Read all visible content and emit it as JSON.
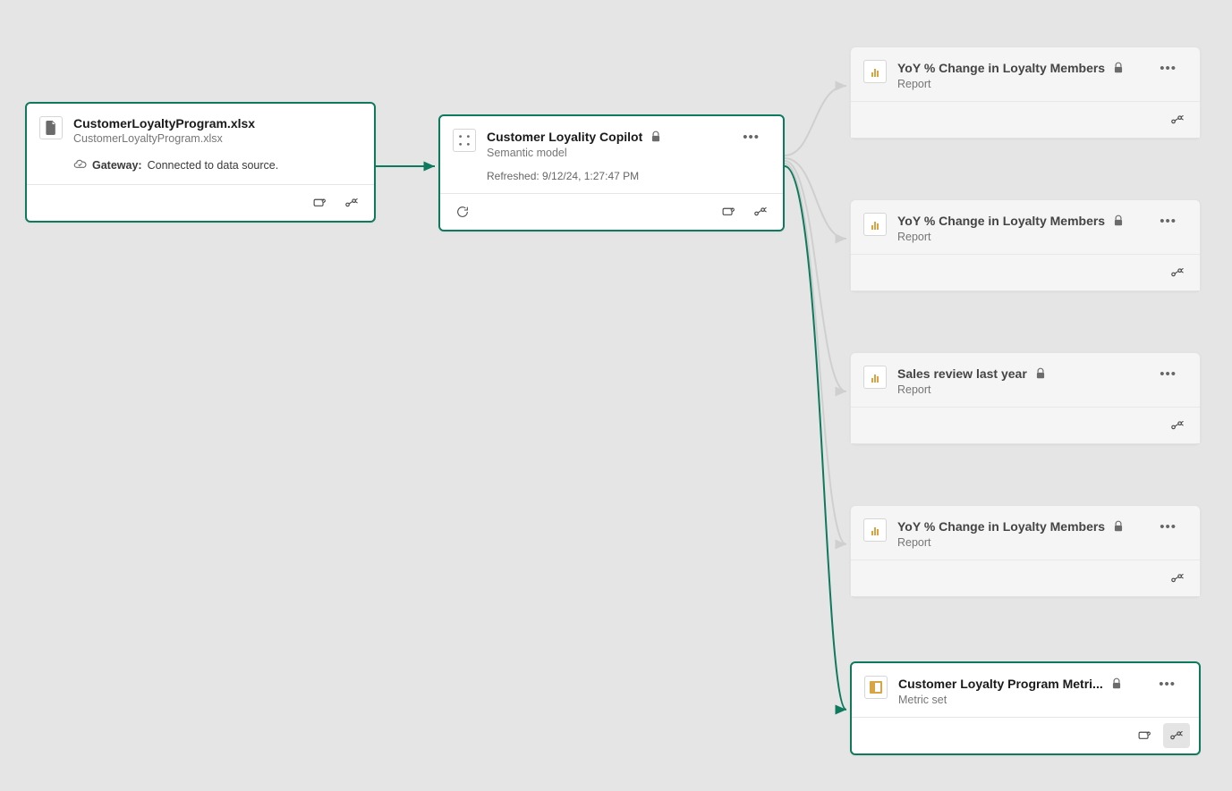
{
  "colors": {
    "accent": "#0e7a5d",
    "inactive_bg": "#f5f5f5"
  },
  "source": {
    "title": "CustomerLoyaltyProgram.xlsx",
    "subtitle": "CustomerLoyaltyProgram.xlsx",
    "gateway_label": "Gateway:",
    "gateway_status": "Connected to data source."
  },
  "model": {
    "title": "Customer Loyality Copilot",
    "subtitle": "Semantic model",
    "refreshed_label": "Refreshed:",
    "refreshed_value": "9/12/24, 1:27:47 PM"
  },
  "downstream": [
    {
      "title": "YoY % Change in Loyalty Members",
      "type": "Report",
      "locked": true,
      "active": false,
      "icon": "report"
    },
    {
      "title": "YoY % Change in Loyalty Members",
      "type": "Report",
      "locked": true,
      "active": false,
      "icon": "report"
    },
    {
      "title": "Sales review last year",
      "type": "Report",
      "locked": true,
      "active": false,
      "icon": "report"
    },
    {
      "title": "YoY % Change in Loyalty Members",
      "type": "Report",
      "locked": true,
      "active": false,
      "icon": "report"
    },
    {
      "title": "Customer Loyalty Program Metri...",
      "type": "Metric set",
      "locked": true,
      "active": true,
      "icon": "metricset"
    }
  ]
}
